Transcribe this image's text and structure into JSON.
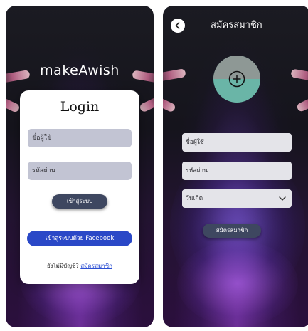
{
  "login_screen": {
    "brand": "makeAwish",
    "card_title": "Login",
    "username_placeholder": "ชื่อผู้ใช้",
    "password_placeholder": "รหัสผ่าน",
    "login_button": "เข้าสู่ระบบ",
    "facebook_button": "เข้าสู่ระบบด้วย Facebook",
    "no_account_text": "ยังไม่มีบัญชี?",
    "signup_link": "สมัครสมาชิก"
  },
  "register_screen": {
    "title": "สมัครสมาชิก",
    "username_placeholder": "ชื่อผู้ใช้",
    "password_placeholder": "รหัสผ่าน",
    "birthday_select": "วันเกิด",
    "register_button": "สมัครสมาชิก",
    "back_icon": "chevron-left-icon",
    "avatar_icon": "add-circle-icon",
    "select_icon": "chevron-down-icon"
  },
  "colors": {
    "facebook_button": "#2a48c7",
    "dark_button": "#3e4760",
    "link": "#2b4fd3",
    "input_fill": "#c2c4d3",
    "avatar_green": "#6ab5a7"
  }
}
